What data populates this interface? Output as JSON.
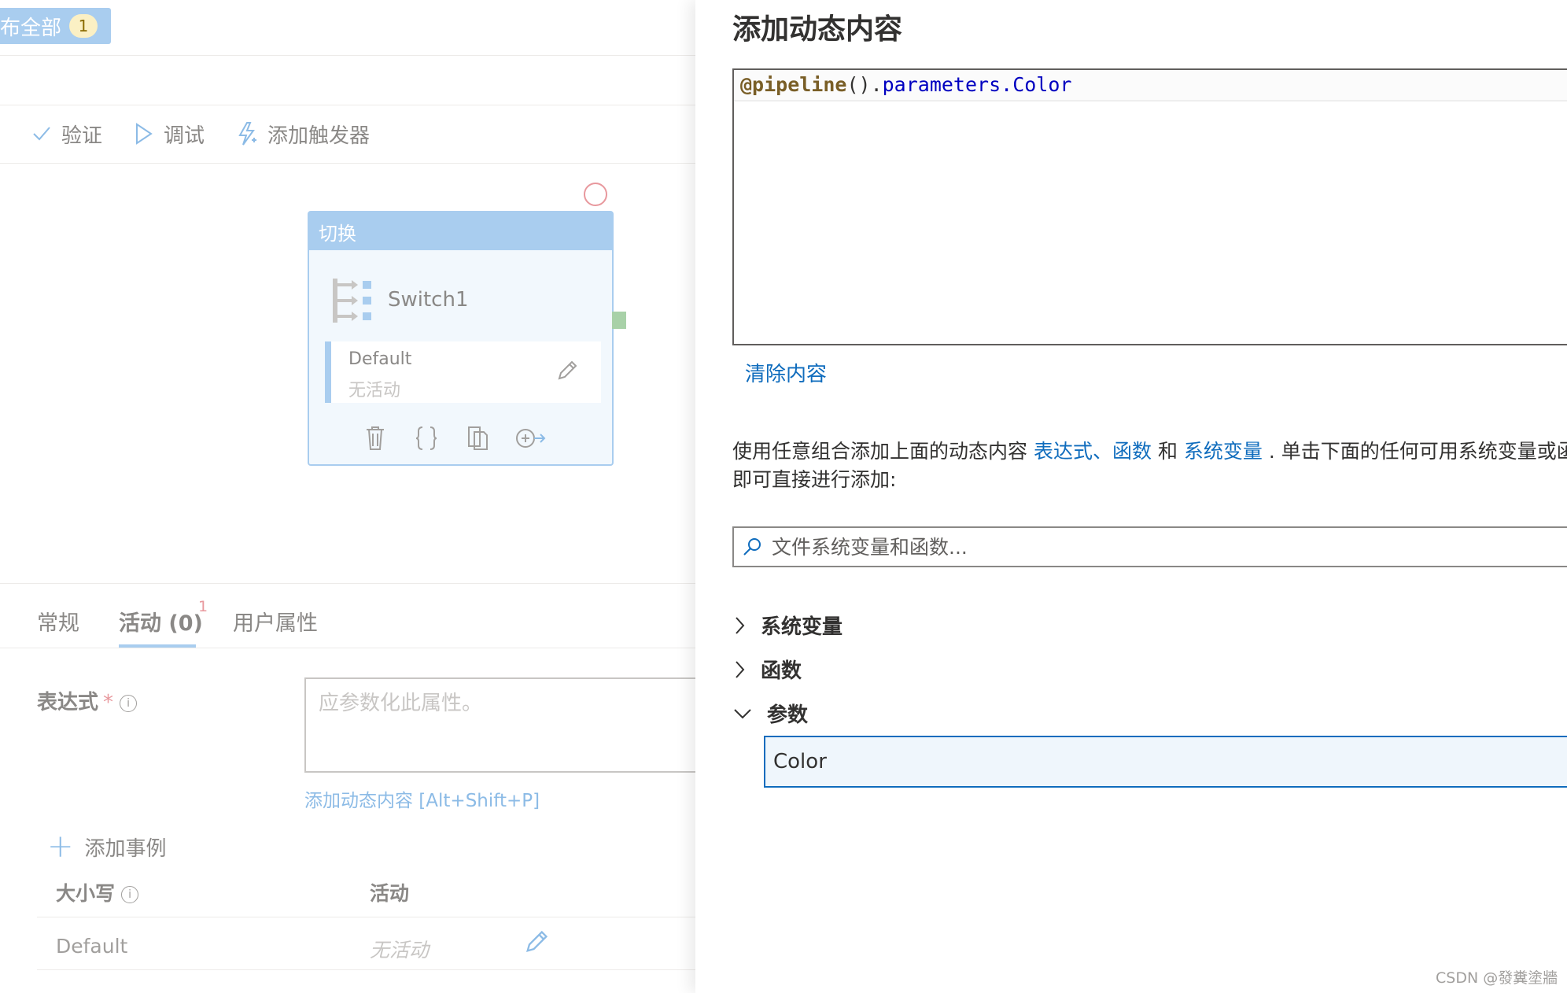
{
  "left": {
    "publish": {
      "label": "布全部",
      "count": "1"
    },
    "toolbar": {
      "validate": "验证",
      "debug": "调试",
      "add_trigger": "添加触发器"
    },
    "switch_card": {
      "header": "切换",
      "name": "Switch1",
      "default_label": "Default",
      "default_value": "无活动"
    },
    "tabs": {
      "general": "常规",
      "activities": "活动 (0)",
      "activities_badge": "1",
      "user_props": "用户属性"
    },
    "expression": {
      "label": "表达式",
      "required": "*",
      "placeholder": "应参数化此属性。",
      "dynamic_link": "添加动态内容 [Alt+Shift+P]"
    },
    "cases": {
      "add_case": "添加事例",
      "col_case": "大小写",
      "col_activity": "活动",
      "row_case": "Default",
      "row_activity": "无活动"
    }
  },
  "panel": {
    "title": "添加动态内容",
    "code": {
      "kw": "@pipeline",
      "paren": "().",
      "prop": "parameters.Color"
    },
    "clear": "清除内容",
    "help": {
      "text1": "使用任意组合添加上面的动态内容 ",
      "link1": "表达式",
      "sep": "、",
      "link2": "函数",
      "text2": " 和 ",
      "link3": "系统变量",
      "text3": " . 单击下面的任何可用系统变量或函数即可直接进行添加:"
    },
    "search_placeholder": "文件系统变量和函数...",
    "tree": {
      "sysvars": "系统变量",
      "functions": "函数",
      "params": "参数",
      "param_item": "Color"
    }
  },
  "watermark": "CSDN @發糞塗牆",
  "colors": {
    "accent": "#0f6cbd",
    "card_header": "#a9cdef",
    "publish_badge": "#fbf0c4"
  }
}
